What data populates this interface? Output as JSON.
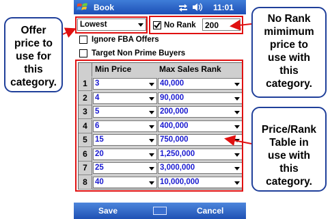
{
  "window": {
    "title": "Book",
    "clock": "11:01"
  },
  "form": {
    "offer_price_value": "Lowest",
    "no_rank_checked": true,
    "no_rank_label": "No Rank",
    "no_rank_min_price": "200",
    "ignore_fba_label": "Ignore FBA Offers",
    "ignore_fba_checked": false,
    "target_nonprime_label": "Target Non Prime Buyers",
    "target_nonprime_checked": false
  },
  "table": {
    "headers": [
      "",
      "Min Price",
      "Max Sales Rank"
    ],
    "rows": [
      {
        "n": "1",
        "price": "3",
        "rank": "40,000"
      },
      {
        "n": "2",
        "price": "4",
        "rank": "90,000"
      },
      {
        "n": "3",
        "price": "5",
        "rank": "200,000"
      },
      {
        "n": "4",
        "price": "6",
        "rank": "400,000"
      },
      {
        "n": "5",
        "price": "15",
        "rank": "750,000"
      },
      {
        "n": "6",
        "price": "20",
        "rank": "1,250,000"
      },
      {
        "n": "7",
        "price": "25",
        "rank": "3,000,000"
      },
      {
        "n": "8",
        "price": "40",
        "rank": "10,000,000"
      }
    ]
  },
  "softkeys": {
    "left": "Save",
    "right": "Cancel"
  },
  "callouts": {
    "offer_price": "Offer\nprice to\nuse for\nthis\ncategory.",
    "no_rank": "No Rank\nmimimum\nprice to\nuse with\nthis\ncategory.",
    "price_rank": "Price/Rank\nTable in\nuse with\nthis\ncategory."
  },
  "colors": {
    "highlight": "#e01010",
    "callout_border": "#1f3f9a",
    "cell_text": "#1a1ad0",
    "titlebar": "#1d4fb6"
  }
}
